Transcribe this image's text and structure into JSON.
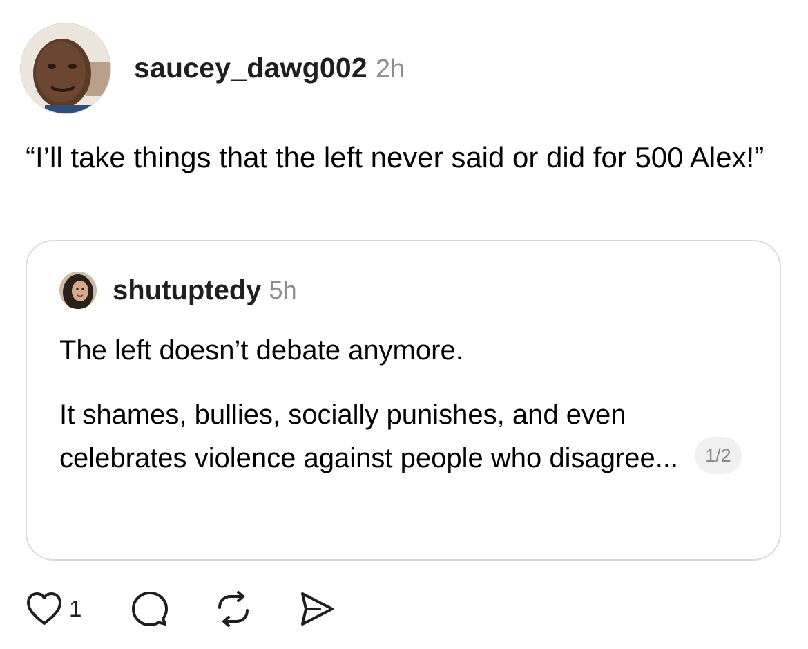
{
  "post": {
    "username": "saucey_dawg002",
    "time": "2h",
    "text": "“I’ll take things that the left never said or did for 500 Alex!”"
  },
  "quoted_post": {
    "username": "shutuptedy",
    "time": "5h",
    "paragraph1": "The left doesn’t debate anymore.",
    "paragraph2": "It shames, bullies, socially punishes, and even celebrates violence against people who disagree...",
    "page_indicator": "1/2"
  },
  "actions": {
    "like_count": "1",
    "icons": [
      "heart-icon",
      "comment-icon",
      "repost-icon",
      "share-icon"
    ]
  },
  "colors": {
    "text": "#000000",
    "muted": "#8e8e8e",
    "card_border": "#dbdbdb",
    "badge_bg": "#f0f0f0"
  }
}
